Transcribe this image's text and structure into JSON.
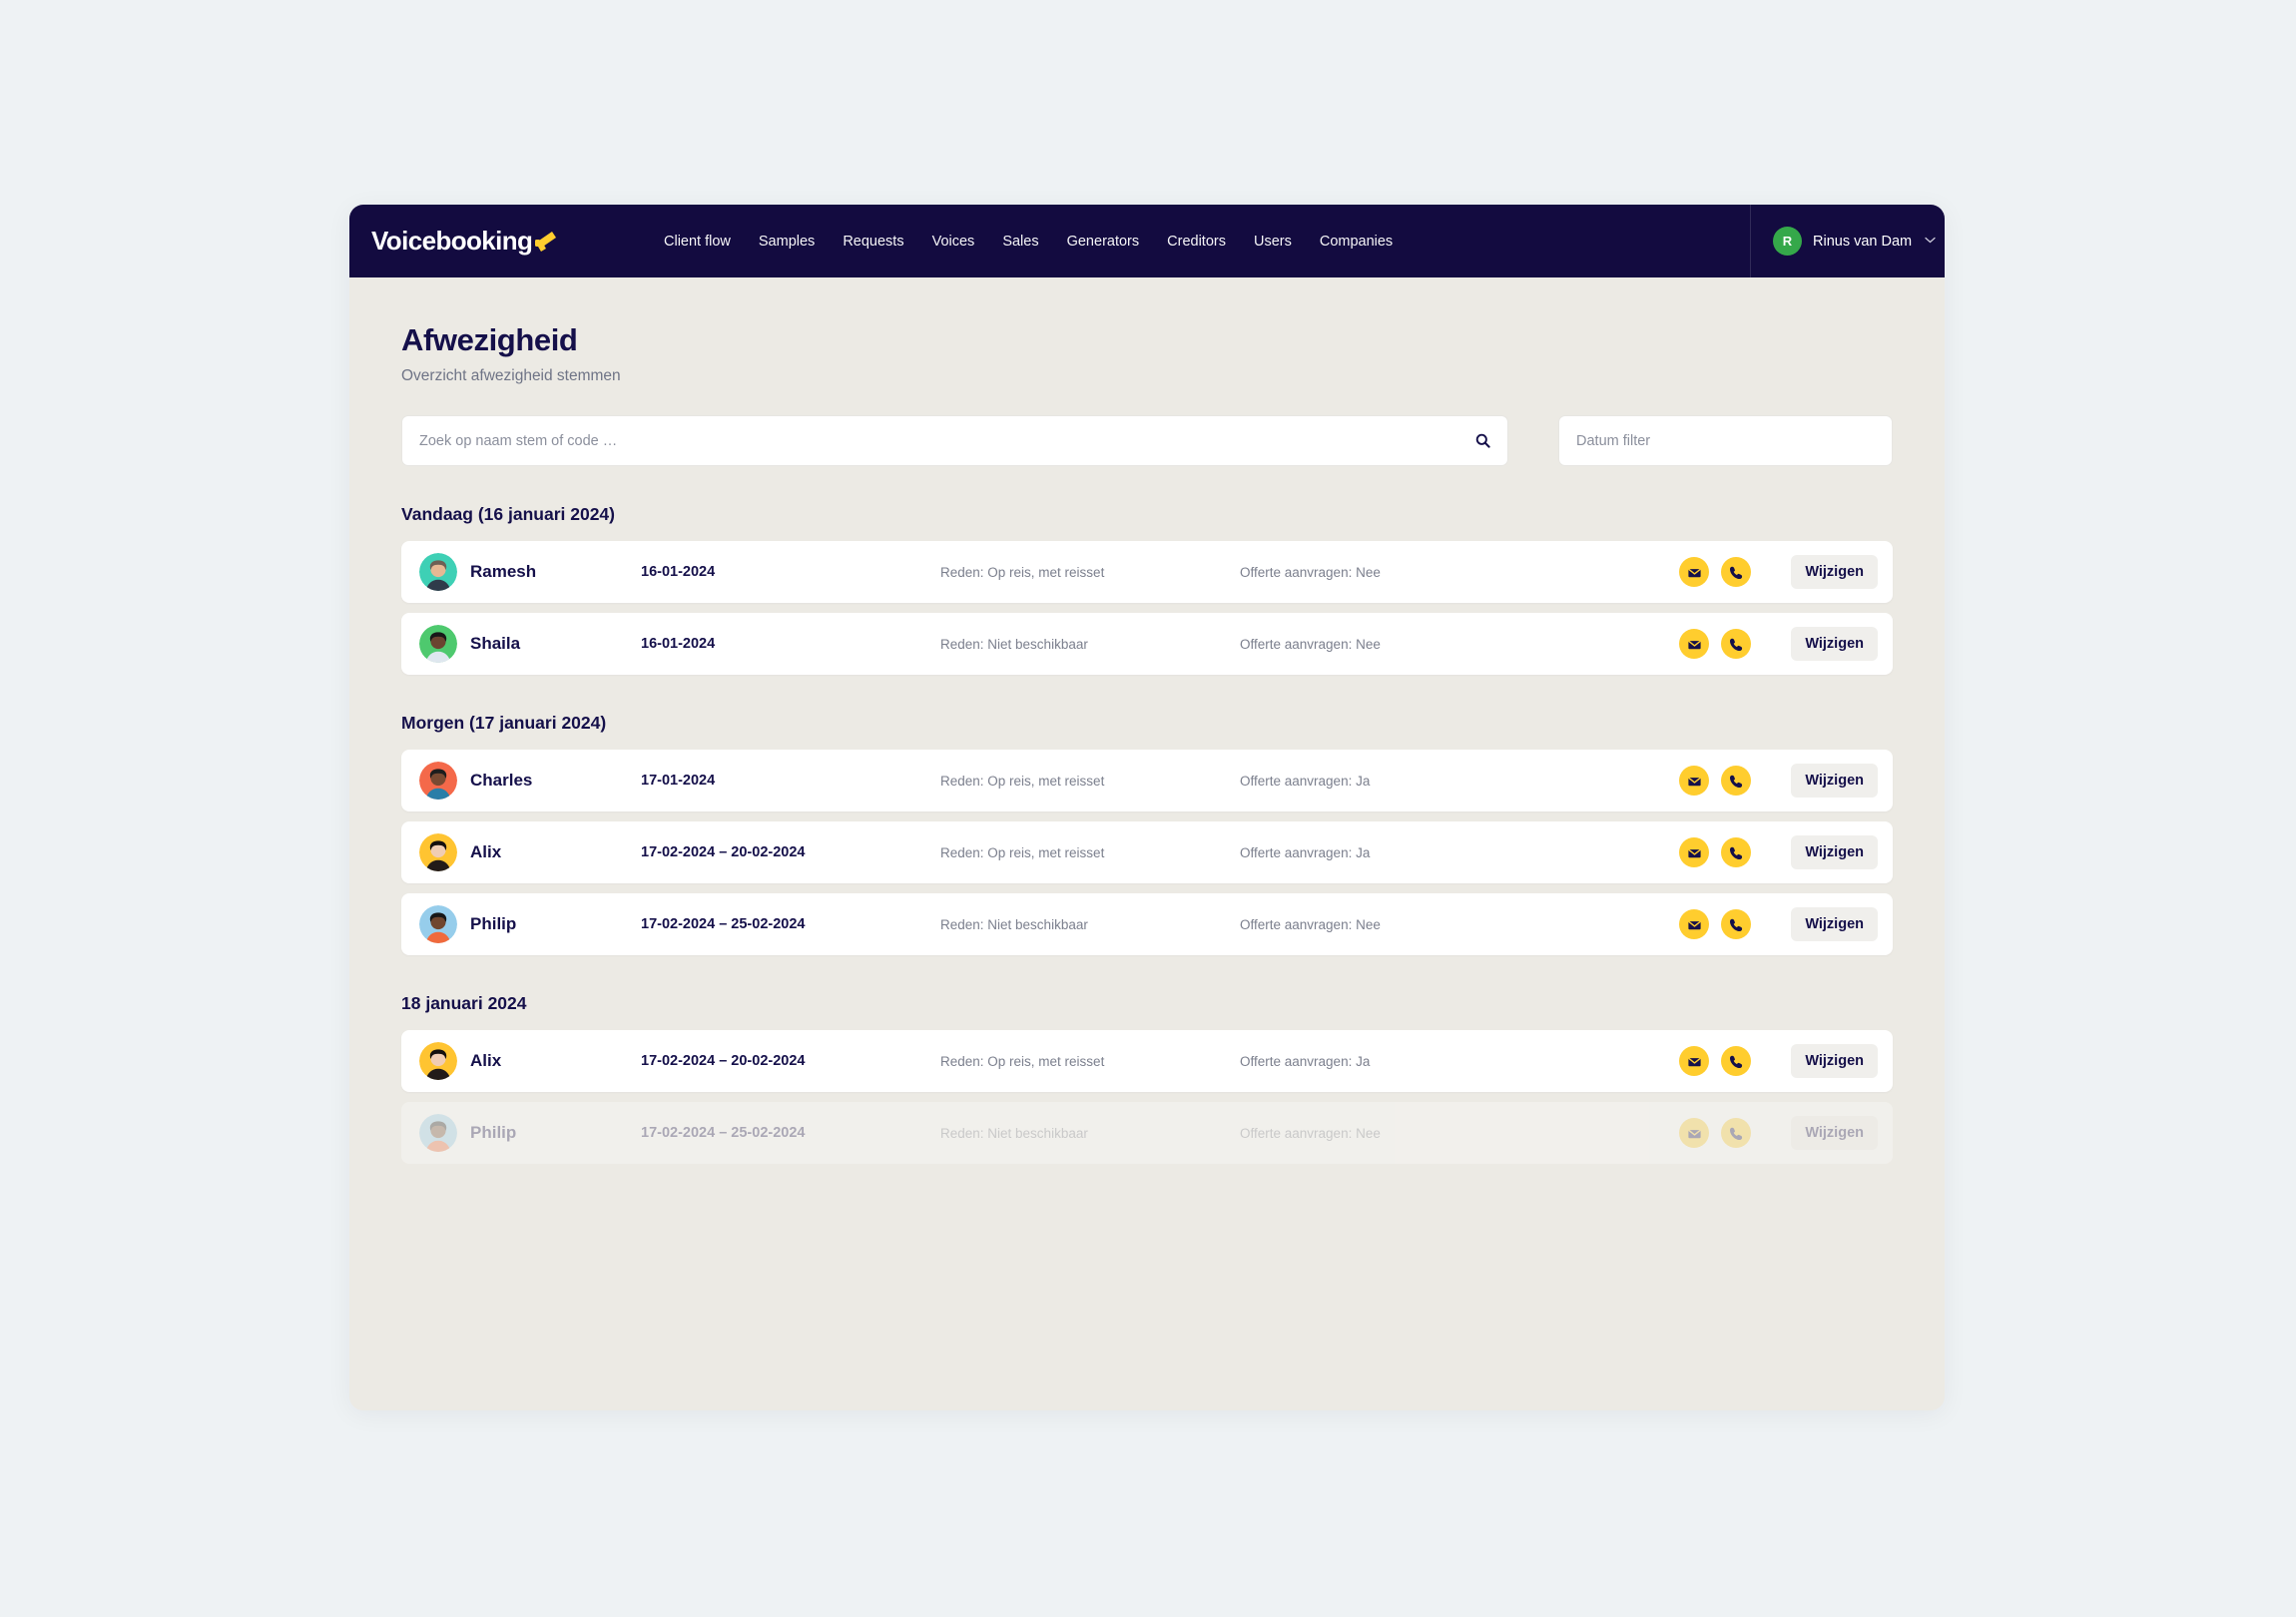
{
  "nav": {
    "brand": "Voicebooking",
    "brand_icon": "megaphone-icon",
    "links": [
      "Client flow",
      "Samples",
      "Requests",
      "Voices",
      "Sales",
      "Generators",
      "Creditors",
      "Users",
      "Companies"
    ],
    "user": {
      "initial": "R",
      "name": "Rinus van Dam",
      "caret": "⌄"
    },
    "colors": {
      "bar": "#130b40",
      "avatar": "#35a84a"
    }
  },
  "page": {
    "title": "Afwezigheid",
    "subtitle": "Overzicht afwezigheid stemmen"
  },
  "filters": {
    "search": {
      "value": "",
      "placeholder": "Zoek op naam stem of code …",
      "icon": "search-icon"
    },
    "date": {
      "value": "",
      "placeholder": "Datum filter"
    }
  },
  "labels": {
    "edit": "Wijzigen",
    "mail_icon": "envelope-icon",
    "phone_icon": "phone-icon"
  },
  "colors": {
    "accent_yellow": "#ffcd2e",
    "navy": "#15104a",
    "page_bg": "#eceae4",
    "desk_bg": "#eef2f4"
  },
  "sections": [
    {
      "title": "Vandaag (16 januari 2024)",
      "rows": [
        {
          "name": "Ramesh",
          "avatar_bg": "#3ed0b5",
          "avatar_skin": "#e6b894",
          "avatar_hair": "#6d6055",
          "avatar_shirt": "#2f3b4a",
          "date": "16-01-2024",
          "reason": "Reden: Op reis, met reisset",
          "offerte": "Offerte aanvragen: Nee",
          "edit": "Wijzigen",
          "faded": false
        },
        {
          "name": "Shaila",
          "avatar_bg": "#4ec96e",
          "avatar_skin": "#6b4430",
          "avatar_hair": "#181818",
          "avatar_shirt": "#dfe7ef",
          "date": "16-01-2024",
          "reason": "Reden: Niet beschikbaar",
          "offerte": "Offerte aanvragen: Nee",
          "edit": "Wijzigen",
          "faded": false
        }
      ]
    },
    {
      "title": "Morgen (17 januari 2024)",
      "rows": [
        {
          "name": "Charles",
          "avatar_bg": "#f4694a",
          "avatar_skin": "#7a4a32",
          "avatar_hair": "#1d1d1d",
          "avatar_shirt": "#2a7ea8",
          "date": "17-01-2024",
          "reason": "Reden: Op reis, met reisset",
          "offerte": "Offerte aanvragen: Ja",
          "edit": "Wijzigen",
          "faded": false
        },
        {
          "name": "Alix",
          "avatar_bg": "#ffc431",
          "avatar_skin": "#f0cdb4",
          "avatar_hair": "#14100f",
          "avatar_shirt": "#221b19",
          "date": "17-02-2024 – 20-02-2024",
          "reason": "Reden: Op reis, met reisset",
          "offerte": "Offerte aanvragen: Ja",
          "edit": "Wijzigen",
          "faded": false
        },
        {
          "name": "Philip",
          "avatar_bg": "#96cdeb",
          "avatar_skin": "#70462e",
          "avatar_hair": "#171717",
          "avatar_shirt": "#f06a3c",
          "date": "17-02-2024 – 25-02-2024",
          "reason": "Reden: Niet beschikbaar",
          "offerte": "Offerte aanvragen: Nee",
          "edit": "Wijzigen",
          "faded": false
        }
      ]
    },
    {
      "title": "18 januari 2024",
      "rows": [
        {
          "name": "Alix",
          "avatar_bg": "#ffc431",
          "avatar_skin": "#f0cdb4",
          "avatar_hair": "#14100f",
          "avatar_shirt": "#221b19",
          "date": "17-02-2024 – 20-02-2024",
          "reason": "Reden: Op reis, met reisset",
          "offerte": "Offerte aanvragen: Ja",
          "edit": "Wijzigen",
          "faded": false
        },
        {
          "name": "Philip",
          "avatar_bg": "#96cdeb",
          "avatar_skin": "#70462e",
          "avatar_hair": "#171717",
          "avatar_shirt": "#f06a3c",
          "date": "17-02-2024 – 25-02-2024",
          "reason": "Reden: Niet beschikbaar",
          "offerte": "Offerte aanvragen: Nee",
          "edit": "Wijzigen",
          "faded": true
        }
      ]
    }
  ]
}
